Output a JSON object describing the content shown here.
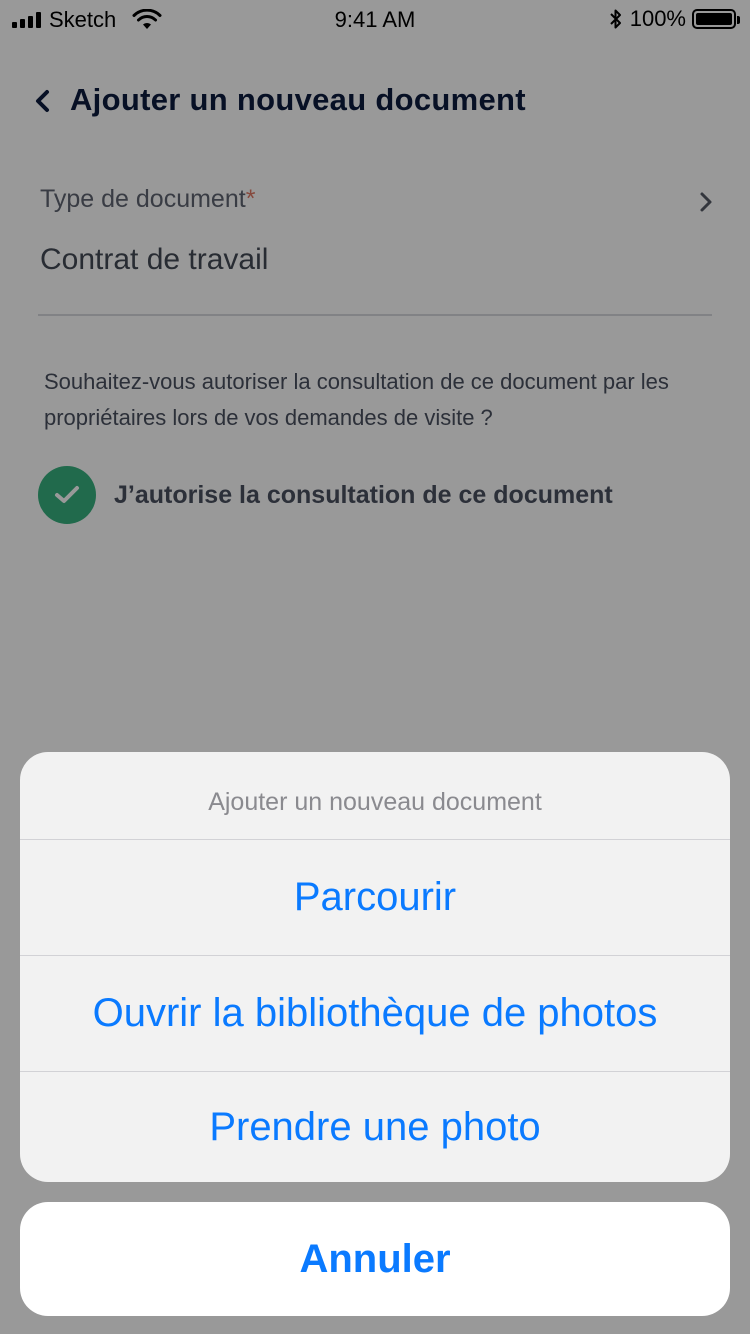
{
  "status_bar": {
    "carrier": "Sketch",
    "time": "9:41 AM",
    "battery_percent": "100%"
  },
  "header": {
    "title": "Ajouter un nouveau document",
    "back_icon": "chevron-left-icon"
  },
  "document_type": {
    "label": "Type de document",
    "required_marker": "*",
    "value": "Contrat de travail",
    "chevron_icon": "chevron-right-icon"
  },
  "consent": {
    "question": "Souhaitez-vous autoriser la consultation de ce document par les propriétaires lors de vos demandes de visite ?",
    "checkbox_label": "J’autorise la consultation de ce document",
    "checked": true
  },
  "action_sheet": {
    "title": "Ajouter un nouveau document",
    "actions": [
      {
        "label": "Parcourir"
      },
      {
        "label": "Ouvrir la bibliothèque de photos"
      },
      {
        "label": "Prendre une photo"
      }
    ],
    "cancel_label": "Annuler"
  },
  "colors": {
    "title": "#0d1b3e",
    "accent_green": "#37b17f",
    "action_blue": "#0a7aff",
    "required_asterisk": "#e07a66"
  }
}
